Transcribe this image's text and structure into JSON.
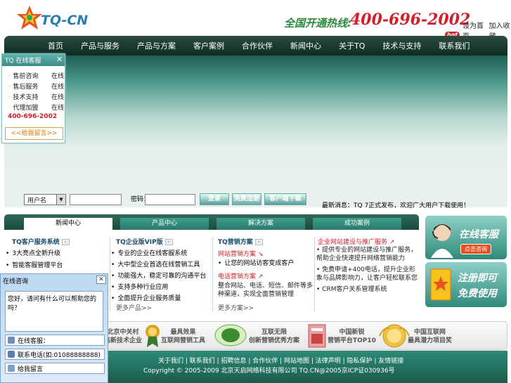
{
  "header": {
    "logo_text": "TQ-CN",
    "hotline_label": "全国开通热线:",
    "hotline_number": "400-696-2002",
    "hot_badge": "hot",
    "top_links": [
      "设为首页",
      "加入收藏"
    ]
  },
  "nav": {
    "items": [
      "首页",
      "产品与服务",
      "产品与方案",
      "客户案例",
      "合作伙伴",
      "新闻中心",
      "关于TQ",
      "技术与支持",
      "联系我们"
    ]
  },
  "float_panel": {
    "title": "TQ 在线客服",
    "rows": [
      {
        "label": "售前咨询",
        "status": "在线"
      },
      {
        "label": "售后服务",
        "status": "在线"
      },
      {
        "label": "技术支持",
        "status": "在线"
      },
      {
        "label": "代理加盟",
        "status": "在线"
      }
    ],
    "phone": "400-696-2002",
    "message_button": "<<给我留言>>"
  },
  "login": {
    "type_value": "用户名",
    "password_label": "密码：",
    "login_button": "登录",
    "register_button": "免费注册",
    "download_button": "客户端下载"
  },
  "news_ticker": "最新消息：TQ 7正式发布，欢迎广大用户下载使用！",
  "tabs": [
    "新闻中心",
    "产品中心",
    "解决方案",
    "成功案例"
  ],
  "columns": {
    "col1": {
      "title": "TQ客户服务系统",
      "items": [
        "3大亮点全新升级",
        "智能客服管理平台"
      ]
    },
    "col2": {
      "title": "TQ企业版VIP版",
      "items": [
        "专业的企业在线客服系统",
        "大中型企业首选在线营销工具",
        "功能强大，稳定可靠的沟通平台",
        "支持多种行业应用",
        "全面提升企业服务质量"
      ],
      "more": "更多产品>>"
    },
    "col3": {
      "title": "TQ营销方案",
      "sub1": "网站营销方案",
      "line1": "让您的网站访客变成客户",
      "sub2": "电话营销方案",
      "line2": "整合网站、电话、短信、邮件等多种渠道，实现全面营销管理",
      "more": "更多方案>>"
    },
    "col4": {
      "title": "企业网站建设与推广服务",
      "items": [
        "提供专业的网站建设与推广服务，帮助企业快速提升网络营销能力",
        "免费申请+400电话，提升企业形象与品牌影响力，让客户轻松联系您",
        "CRM客户关系管理系统"
      ]
    }
  },
  "ads": {
    "service_title": "在线客服",
    "service_button": "点击咨询",
    "register_title1": "注册即可",
    "register_title2": "免费使用"
  },
  "awards": [
    {
      "line1": "北京中关村",
      "line2": "高新技术企业"
    },
    {
      "line1": "最具效果",
      "line2": "互联网营销工具"
    },
    {
      "line1": "互联无限",
      "line2": "创新营销优秀方案"
    },
    {
      "line1": "中国新锐",
      "line2": "营销平台TOP10"
    },
    {
      "line1": "中国互联网",
      "line2": "最具潜力项目奖"
    }
  ],
  "footer": {
    "links": "关于我们 | 联系我们 | 招聘信息 | 合作伙伴 | 网站地图 | 法律声明 | 隐私保护 | 友情链接",
    "copyright": "Copyright © 2005-2009 北京天启网络科技有限公司 TQ.CN@2005京ICP证030936号"
  },
  "chat_widget": {
    "title": "在线咨询",
    "message": "您好，请问有什么可以帮助您的吗？",
    "rows": [
      "在线客服：",
      "联系电话(如:01088888888)",
      "给我留言"
    ]
  },
  "colors": {
    "brand_teal": "#2c8b78",
    "hotline_red": "#d0202a",
    "nav_dark": "#193a2e"
  }
}
